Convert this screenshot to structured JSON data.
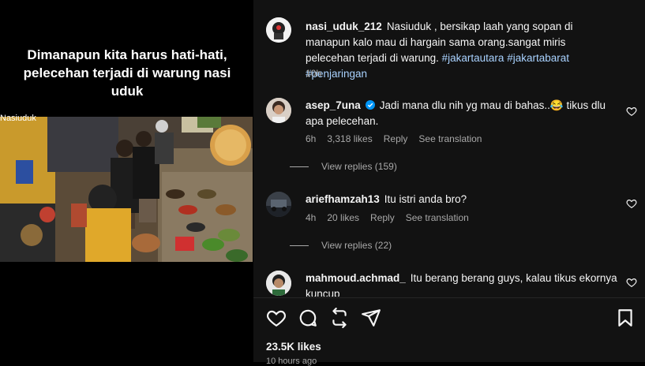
{
  "video": {
    "caption": "Dimanapun kita harus hati-hati, pelecehan terjadi di warung nasi uduk",
    "cam_label": "Nasiuduk"
  },
  "post": {
    "username": "nasi_uduk_212",
    "text": "Nasiuduk , bersikap laah yang sopan di manapun kalo mau di hargain sama orang.sangat miris pelecehan terjadi di warung.",
    "hashtags": [
      "#jakartautara",
      "#jakartabarat",
      "#penjaringan"
    ],
    "time": "10h"
  },
  "comments": [
    {
      "username": "asep_7una",
      "verified": true,
      "text": "Jadi mana dlu nih yg mau di bahas..😂 tikus dlu apa pelecehan.",
      "time": "6h",
      "likes": "3,318 likes",
      "reply": "Reply",
      "translate": "See translation",
      "view_replies": "View replies (159)"
    },
    {
      "username": "ariefhamzah13",
      "verified": false,
      "text": "Itu istri anda bro?",
      "time": "4h",
      "likes": "20 likes",
      "reply": "Reply",
      "translate": "See translation",
      "view_replies": "View replies (22)"
    },
    {
      "username": "mahmoud.achmad_",
      "verified": false,
      "text": "Itu berang berang guys, kalau tikus ekornya kuncup"
    }
  ],
  "actions": {
    "icons": [
      "heart-icon",
      "comment-icon",
      "share-icon",
      "send-icon",
      "bookmark-icon"
    ]
  },
  "footer": {
    "likes": "23.5K likes",
    "time": "10 hours ago"
  },
  "colors": {
    "background": "#121212",
    "secondary_text": "#a8a8a8",
    "verified": "#0095f6",
    "hashtag": "#a9d2ff"
  }
}
